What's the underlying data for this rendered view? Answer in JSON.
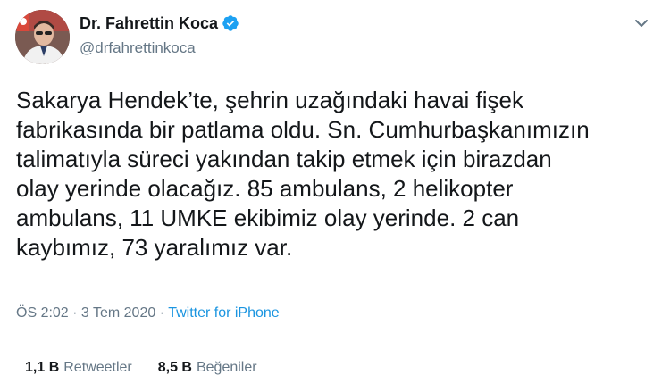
{
  "author": {
    "display_name": "Dr. Fahrettin Koca",
    "handle": "@drfahrettinkoca",
    "verified": true,
    "verified_icon": "verified-badge-icon",
    "avatar_icon": "profile-photo"
  },
  "menu": {
    "icon": "chevron-down-icon"
  },
  "tweet": {
    "text": "Sakarya Hendek’te, şehrin uzağındaki havai fişek\nfabrikasında bir patlama oldu. Sn. Cumhurbaşkanımızın\ntalimatıyla süreci yakından takip etmek için birazdan\nolay yerinde olacağız. 85 ambulans, 2 helikopter\nambulans, 11 UMKE ekibimiz olay yerinde. 2 can\nkaybımız, 73 yaralımız var."
  },
  "meta": {
    "time": "ÖS 2:02",
    "separator": " · ",
    "date": "3 Tem 2020",
    "source": "Twitter for iPhone"
  },
  "stats": {
    "retweets_count": "1,1 B",
    "retweets_label": "Retweetler",
    "likes_count": "8,5 B",
    "likes_label": "Beğeniler"
  },
  "colors": {
    "verified": "#1da1f2",
    "link": "#1b95e0",
    "secondary_text": "#657786",
    "primary_text": "#14171a"
  }
}
